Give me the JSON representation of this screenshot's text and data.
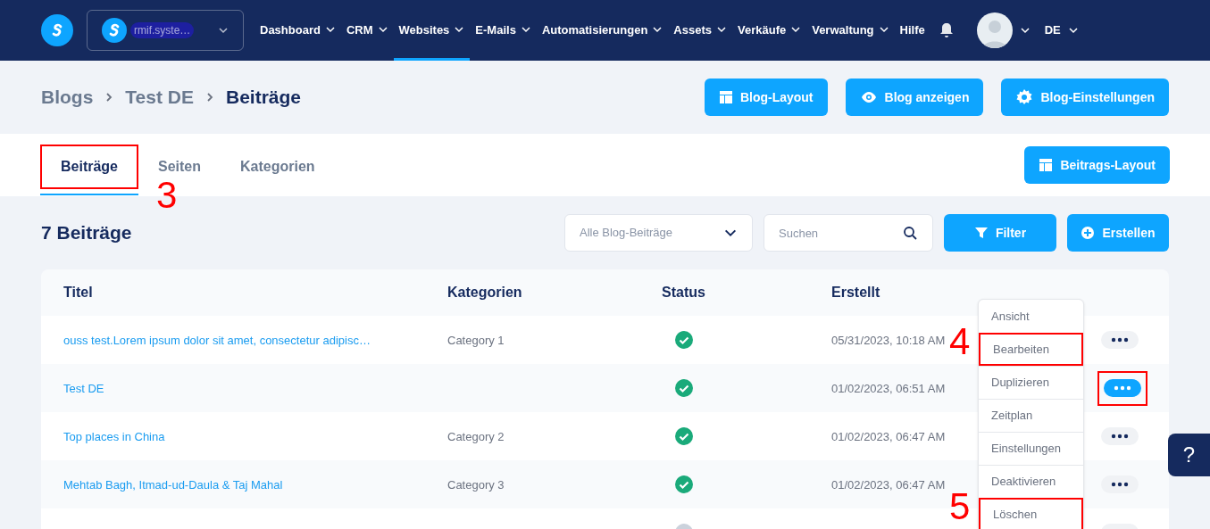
{
  "nav": {
    "account": "rmif.syste…",
    "items": [
      {
        "label": "Dashboard",
        "selected": false
      },
      {
        "label": "CRM",
        "selected": false
      },
      {
        "label": "Websites",
        "selected": true
      },
      {
        "label": "E-Mails",
        "selected": false
      },
      {
        "label": "Automatisierungen",
        "selected": false
      },
      {
        "label": "Assets",
        "selected": false
      },
      {
        "label": "Verkäufe",
        "selected": false
      },
      {
        "label": "Verwaltung",
        "selected": false
      }
    ],
    "help": "Hilfe",
    "language": "DE"
  },
  "breadcrumb": [
    "Blogs",
    "Test DE",
    "Beiträge"
  ],
  "header_buttons": [
    {
      "label": "Blog-Layout",
      "kind": "layout"
    },
    {
      "label": "Blog anzeigen",
      "kind": "eye"
    },
    {
      "label": "Blog-Einstellungen",
      "kind": "gear"
    }
  ],
  "tabs": [
    {
      "label": "Beiträge",
      "selected": true,
      "annotated": true,
      "step": "3"
    },
    {
      "label": "Seiten",
      "selected": false,
      "annotated": false
    },
    {
      "label": "Kategorien",
      "selected": false,
      "annotated": false
    }
  ],
  "tab_button": "Beitrags-Layout",
  "count_title": "7 Beiträge",
  "filter_select": "Alle Blog-Beiträge",
  "search": {
    "placeholder": "Suchen"
  },
  "filter_button": "Filter",
  "create_button": "Erstellen",
  "table": {
    "columns": [
      "Titel",
      "Kategorien",
      "Status",
      "Erstellt"
    ],
    "rows": [
      {
        "title": "ouss test.Lorem ipsum dolor sit amet, consectetur adipisc…",
        "category": "Category 1",
        "active": true,
        "created": "05/31/2023, 10:18 AM",
        "selected": false,
        "annotated": false
      },
      {
        "title": "Test DE",
        "active": true,
        "created": "01/02/2023, 06:51 AM",
        "selected": true,
        "annotated": true
      },
      {
        "title": "Top places in China",
        "category": "Category 2",
        "active": true,
        "created": "01/02/2023, 06:47 AM",
        "selected": false,
        "annotated": false
      },
      {
        "title": "Mehtab Bagh, Itmad-ud-Daula & Taj Mahal",
        "category": "Category 3",
        "active": true,
        "created": "01/02/2023, 06:47 AM",
        "selected": false,
        "annotated": false
      },
      {
        "active": false,
        "selected": false,
        "annotated": false
      }
    ]
  },
  "menu": [
    {
      "label": "Ansicht",
      "annotated": false
    },
    {
      "label": "Bearbeiten",
      "annotated": true,
      "step": "4"
    },
    {
      "label": "Duplizieren",
      "annotated": false
    },
    {
      "label": "Zeitplan",
      "annotated": false
    },
    {
      "label": "Einstellungen",
      "annotated": false
    },
    {
      "label": "Deaktivieren",
      "annotated": false
    },
    {
      "label": "Löschen",
      "annotated": true,
      "step": "5"
    }
  ],
  "help_button": "?"
}
